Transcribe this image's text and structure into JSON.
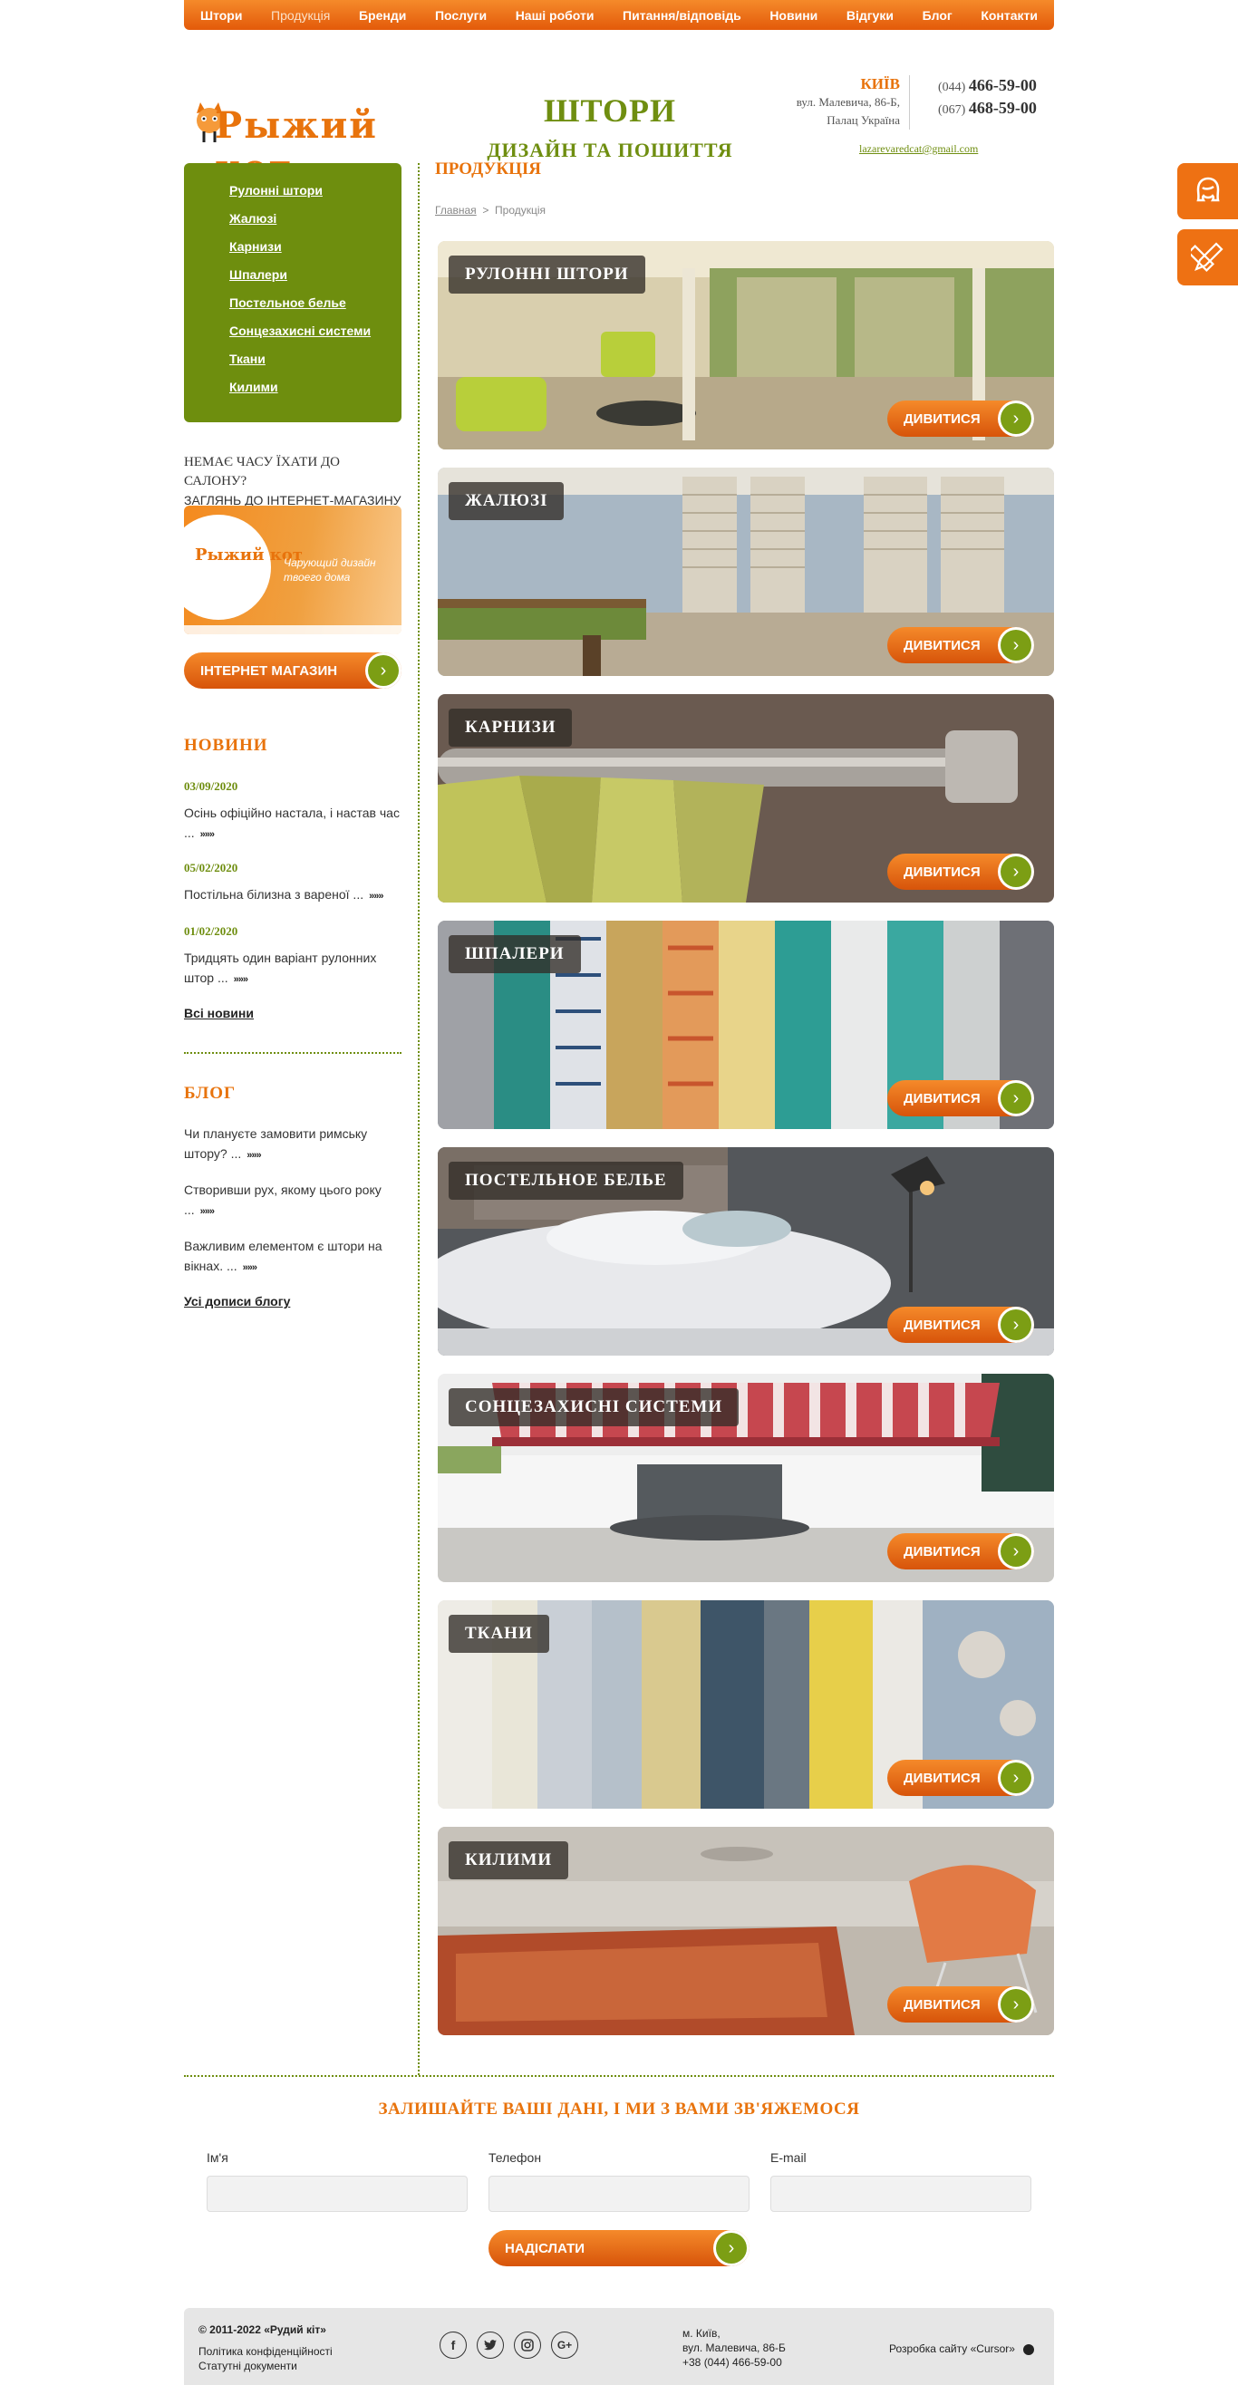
{
  "nav": {
    "items": [
      "Штори",
      "Продукція",
      "Бренди",
      "Послуги",
      "Наші роботи",
      "Питання/відповідь",
      "Новини",
      "Відгуки",
      "Блог",
      "Контакти"
    ],
    "active": "Продукція"
  },
  "header": {
    "logo_text": "Рыжий кот",
    "slogan_main": "ШТОРИ",
    "slogan_sub": "ДИЗАЙН ТА ПОШИТТЯ",
    "city": "КИЇВ",
    "address_line1": "вул. Малевича, 86-Б,",
    "address_line2": "Палац Україна",
    "phone1_code": "(044)",
    "phone1_number": "466-59-00",
    "phone2_code": "(067)",
    "phone2_number": "468-59-00",
    "email": "lazarevaredcat@gmail.com"
  },
  "sidebar": {
    "menu": [
      "Рулонні штори",
      "Жалюзі",
      "Карнизи",
      "Шпалери",
      "Постельное белье",
      "Сонцезахисні системи",
      "Ткани",
      "Килими"
    ],
    "no_time_line1": "НЕМАЄ ЧАСУ ЇХАТИ ДО САЛОНУ?",
    "no_time_line2": "ЗАГЛЯНЬ ДО ІНТЕРНЕТ-МАГАЗИНУ",
    "banner_logo": "Рыжий кот",
    "banner_text": "Чарующий дизайн твоего дома",
    "shop_button": "ІНТЕРНЕТ МАГАЗИН",
    "news_title": "НОВИНИ",
    "news": [
      {
        "date": "03/09/2020",
        "text": "Осінь офіційно настала, і настав час ..."
      },
      {
        "date": "05/02/2020",
        "text": "Постільна білизна з вареної ..."
      },
      {
        "date": "01/02/2020",
        "text": "Тридцять один варіант рулонних штор ..."
      }
    ],
    "news_more": "»»»",
    "all_news": "Всі новини",
    "blog_title": "БЛОГ",
    "blog": [
      "Чи плануєте замовити римську штору? ...",
      "Створивши рух, якому цього року ...",
      "Важливим елементом є штори на вікнах. ..."
    ],
    "all_blog": "Усі дописи блогу"
  },
  "main": {
    "title": "ПРОДУКЦІЯ",
    "breadcrumb_home": "Главная",
    "breadcrumb_sep": ">",
    "breadcrumb_current": "Продукція",
    "see_label": "ДИВИТИСЯ",
    "cards": [
      {
        "label": "РУЛОННІ ШТОРИ"
      },
      {
        "label": "ЖАЛЮЗІ"
      },
      {
        "label": "КАРНИЗИ"
      },
      {
        "label": "ШПАЛЕРИ"
      },
      {
        "label": "ПОСТЕЛЬНОЕ БЕЛЬЕ"
      },
      {
        "label": "СОНЦЕЗАХИСНІ СИСТЕМИ"
      },
      {
        "label": "ТКАНИ"
      },
      {
        "label": "КИЛИМИ"
      }
    ]
  },
  "form": {
    "title": "ЗАЛИШАЙТЕ ВАШІ ДАНІ, І МИ З ВАМИ ЗВ'ЯЖЕМОСЯ",
    "name_label": "Ім'я",
    "phone_label": "Телефон",
    "email_label": "E-mail",
    "submit": "НАДІСЛАТИ"
  },
  "footer": {
    "copyright": "© 2011-2022 «Рудий кіт»",
    "privacy": "Політика конфіденційності",
    "docs": "Статутні документи",
    "city": "м. Київ,",
    "street": "вул. Малевича, 86-Б",
    "phone": "+38 (044) 466-59-00",
    "developer": "Розробка сайту «Cursor»",
    "social_icons": [
      "facebook-icon",
      "twitter-icon",
      "instagram-icon",
      "google-plus-icon"
    ]
  },
  "colors": {
    "orange": "#e8730c",
    "green": "#6f8e10"
  }
}
